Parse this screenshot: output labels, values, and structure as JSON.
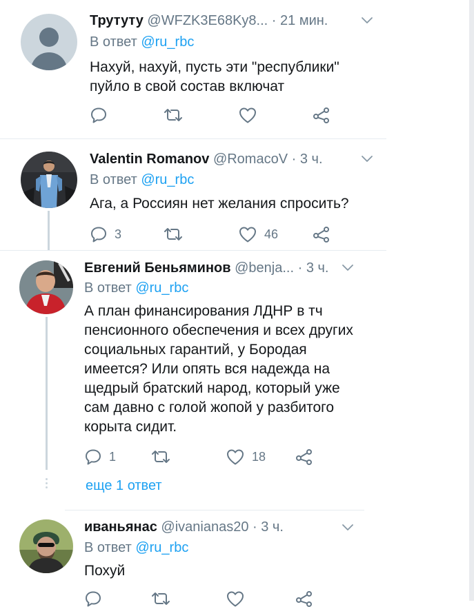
{
  "tweets": [
    {
      "name": "Трутуту",
      "handle": "@WFZK3E68Ky8...",
      "dot": "·",
      "time": "21 мин.",
      "reply_prefix": "В ответ",
      "reply_to": "@ru_rbc",
      "text": "Нахуй, нахуй, пусть эти \"республики\" пуйло в свой состав включат",
      "replies": "",
      "likes": "",
      "avatar": "default-avatar"
    },
    {
      "name": "Valentin Romanov",
      "handle": "@RomacoV",
      "dot": "·",
      "time": "3 ч.",
      "reply_prefix": "В ответ",
      "reply_to": "@ru_rbc",
      "text": "Ага, а Россиян нет желания спросить?",
      "replies": "3",
      "likes": "46",
      "avatar": "photo-man-in-suit"
    },
    {
      "name": "Евгений Беньяминов",
      "handle": "@benja...",
      "dot": "·",
      "time": "3 ч.",
      "reply_prefix": "В ответ",
      "reply_to": "@ru_rbc",
      "text": "А план финансирования ЛДНР в тч пенсионного обеспечения и всех других социальных гарантий, у Бородая имеется? Или опять вся надежда на щедрый братский народ, который уже сам давно с голой жопой у разбитого корыта сидит.",
      "replies": "1",
      "likes": "18",
      "more_replies": "еще 1 ответ",
      "avatar": "photo-man-red-jacket"
    },
    {
      "name": "иваньянас",
      "handle": "@ivanianas20",
      "dot": "·",
      "time": "3 ч.",
      "reply_prefix": "В ответ",
      "reply_to": "@ru_rbc",
      "text": "Похуй",
      "replies": "",
      "likes": "",
      "avatar": "photo-man-sunglasses"
    }
  ],
  "colors": {
    "text": "#14171a",
    "secondary": "#657786",
    "link": "#1da1f2",
    "separator": "#e6ecf0"
  }
}
